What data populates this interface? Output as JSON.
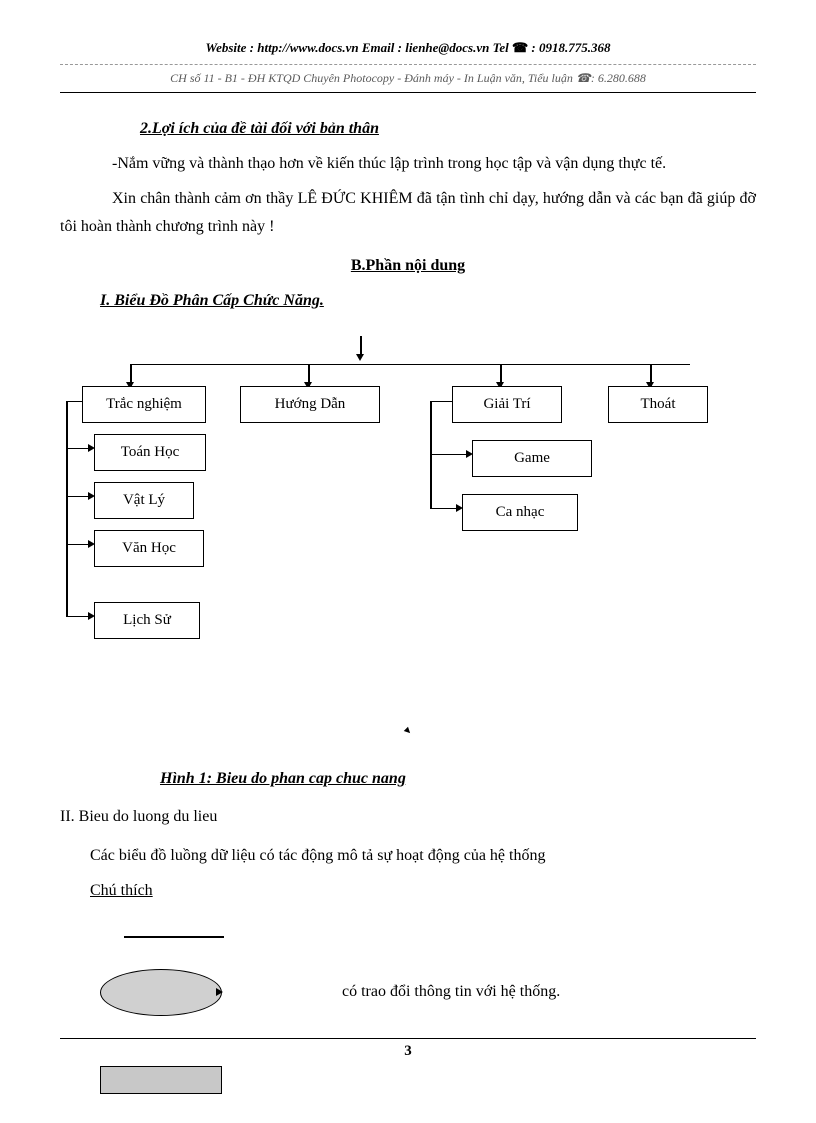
{
  "header": {
    "website_label": "Website",
    "website_value": " : http://www.docs.vn ",
    "email_label": "Email",
    "email_value": " : lienhe@docs.vn ",
    "tel_label": "Tel ",
    "tel_icon": "☎",
    "tel_value": ": 0918.775.368",
    "sub": "CH số 11 - B1 - ĐH KTQD Chuyên Photocopy - Đánh máy - In Luận văn, Tiểu luận ☎: 6.280.688"
  },
  "sec2_title": "2.Lợi ích của đề tài đối với bản thân",
  "p1": "-Nắm vững và thành thạo hơn về kiến thúc lập trình trong học tập và vận dụng thực tế.",
  "p2": "Xin chân thành cảm ơn thầy  LÊ ĐỨC KHIÊM đã tận tình chỉ dạy, hướng dẫn và các bạn đã giúp đỡ tôi hoàn thành chương trình này !",
  "b_title": "B.Phần nội dung",
  "sec_i": "I.  Biểu Đồ Phân Cấp Chức Năng.",
  "diagram": {
    "trac_nghiem": "Trắc nghiệm",
    "toan_hoc": "Toán Học",
    "vat_ly": "Vật Lý",
    "van_hoc": "Văn Học",
    "lich_su": "Lịch Sử",
    "huong_dan": "Hướng  Dẫn",
    "giai_tri": "Giải Trí",
    "game": "Game",
    "ca_nhac": "Ca nhạc",
    "thoat": "Thoát"
  },
  "fig1": "Hình 1: Bieu do phan cap chuc nang",
  "sec_ii": "II.   Bieu  do luong  du lieu",
  "p3": "Các biểu đồ luồng dữ liệu  có tác động mô tả sự hoạt động của hệ thống",
  "chu_thich": "Chú thích",
  "legend_text": "có  trao đổi thông tin với  hệ thống.",
  "pageno": "3"
}
